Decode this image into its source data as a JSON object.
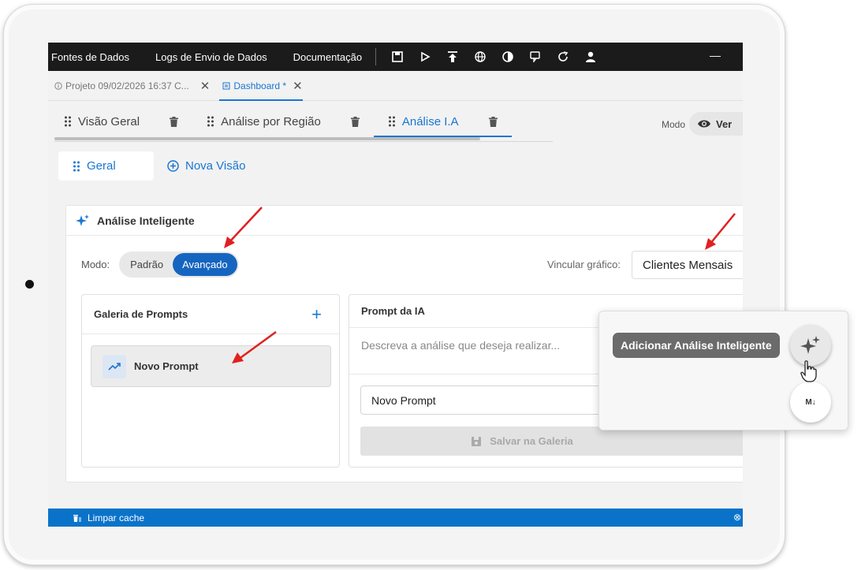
{
  "topbar": {
    "menu": [
      "Fontes de Dados",
      "Logs de Envio de Dados",
      "Documentação"
    ],
    "icons": [
      "save-icon",
      "play-icon",
      "upload-icon",
      "globe-icon",
      "contrast-icon",
      "chat-icon",
      "refresh-icon",
      "user-icon"
    ],
    "minimize": "—"
  },
  "doc_tabs": [
    {
      "label": "Projeto 09/02/2026 16:37 C...",
      "close": "✕",
      "icon": "info-icon"
    },
    {
      "label": "Dashboard *",
      "close": "✕",
      "icon": "dashboard-icon"
    }
  ],
  "view_tabs": [
    {
      "label": "Visão Geral"
    },
    {
      "label": "Análise por Região"
    },
    {
      "label": "Análise I.A"
    }
  ],
  "mode": {
    "label": "Modo",
    "value": "Ver"
  },
  "subviews": {
    "geral": "Geral",
    "nova": "Nova Visão"
  },
  "panel": {
    "title": "Análise Inteligente",
    "modo_label": "Modo:",
    "modo_options": [
      "Padrão",
      "Avançado"
    ],
    "modo_selected": "Avançado",
    "vincular_label": "Vincular gráfico:",
    "vincular_value": "Clientes Mensais"
  },
  "gallery": {
    "title": "Galeria de Prompts",
    "add": "+",
    "items": [
      "Novo Prompt"
    ]
  },
  "prompt_ia": {
    "title": "Prompt da IA",
    "placeholder": "Descreva a análise que deseja realizar...",
    "name_value": "Novo Prompt",
    "save_label": "Salvar na Galeria"
  },
  "statusbar": {
    "clear_cache": "Limpar cache",
    "close": "⊗"
  },
  "popup": {
    "tooltip": "Adicionar Análise Inteligente",
    "md_label": "M↓"
  },
  "colors": {
    "accent": "#1976d2",
    "topbar": "#1b1b1b",
    "statusbar": "#0a73c9",
    "arrow": "#e02020"
  }
}
